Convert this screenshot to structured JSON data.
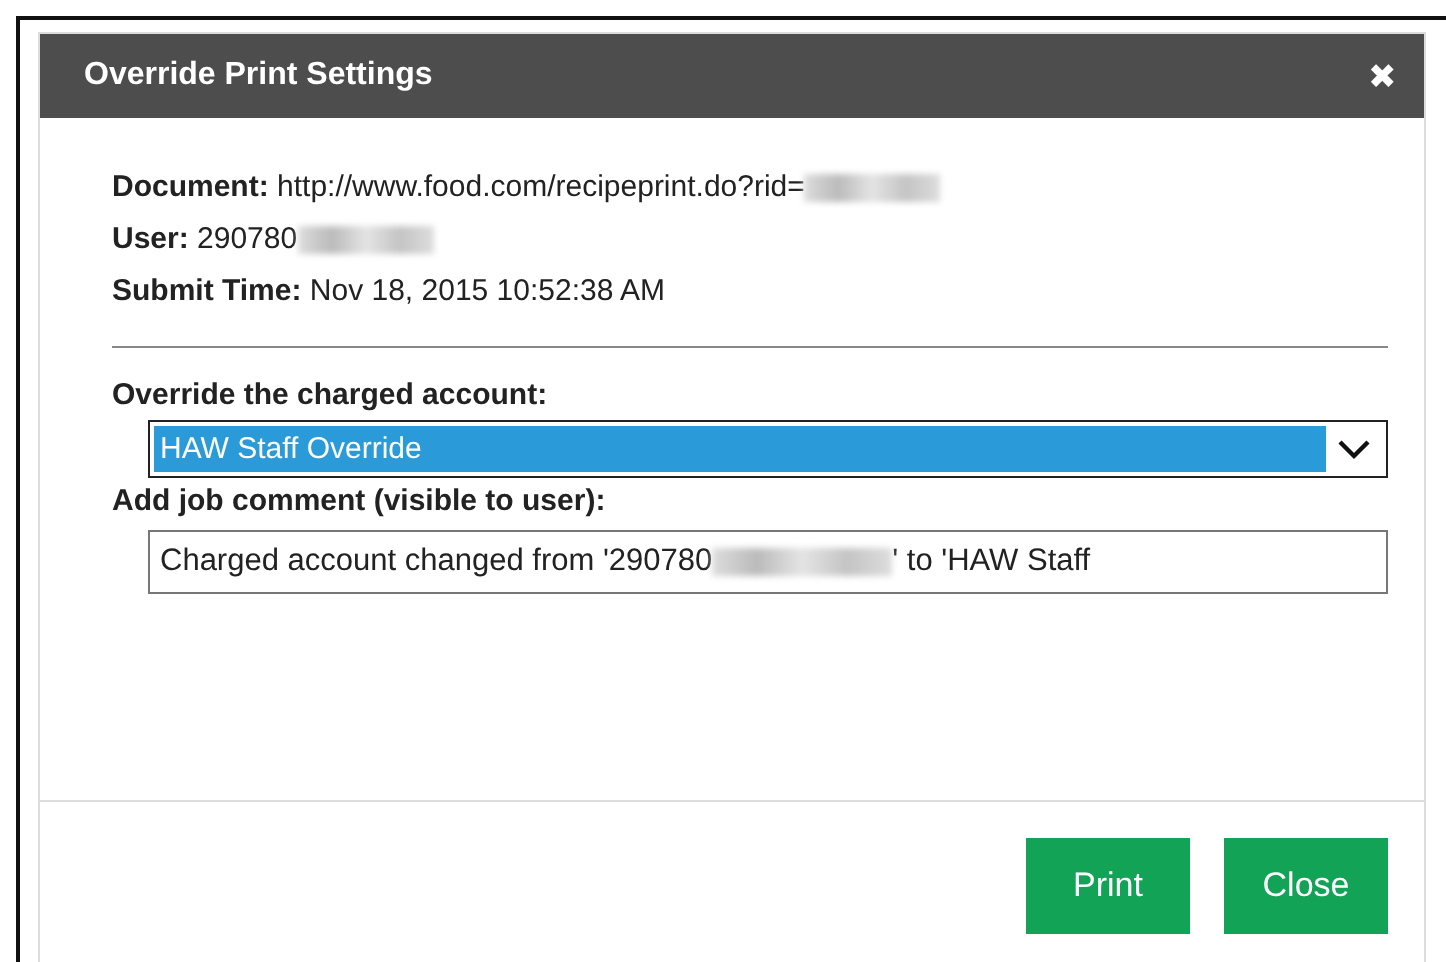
{
  "dialog": {
    "title": "Override Print Settings",
    "close": "✖"
  },
  "info": [
    {
      "label": "Document:",
      "value": "http://www.food.com/recipeprint.do?rid=",
      "redacted": true
    },
    {
      "label": "User:",
      "value": "290780",
      "redacted": true
    },
    {
      "label": "Submit Time:",
      "value": "Nov 18, 2015 10:52:38 AM",
      "redacted": false
    }
  ],
  "account": {
    "label": "Override the charged account:",
    "value": "HAW Staff Override",
    "highlighted": true
  },
  "comment": {
    "label": "Add job comment (visible to user):",
    "before": "Charged account changed from '290780",
    "after": "' to 'HAW Staff"
  },
  "buttons": [
    "Print",
    "Close"
  ]
}
